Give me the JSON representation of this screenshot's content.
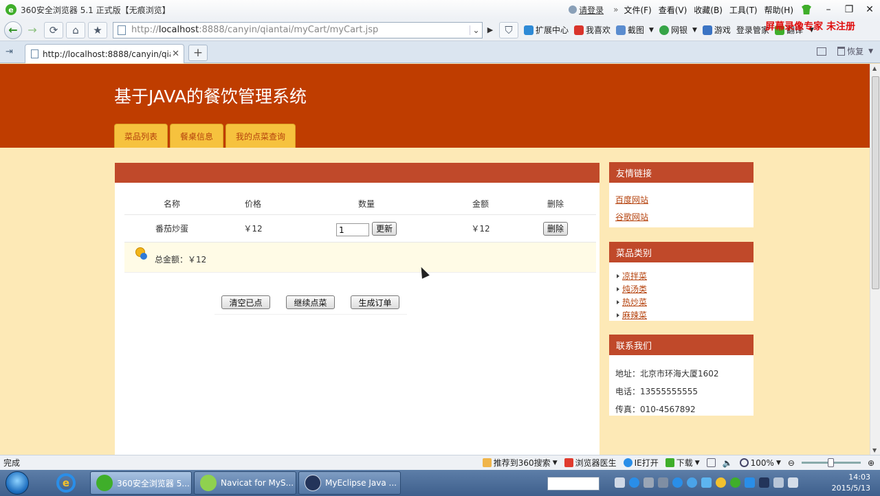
{
  "browser": {
    "window_title": "360安全浏览器 5.1 正式版【无痕浏览】",
    "login": "请登录",
    "menus": [
      "文件(F)",
      "查看(V)",
      "收藏(B)",
      "工具(T)",
      "帮助(H)"
    ],
    "url_prefix": "http://",
    "url_host": "localhost",
    "url_rest": ":8888/canyin/qiantai/myCart/myCart.jsp",
    "extensions": [
      "扩展中心",
      "我喜欢",
      "截图",
      "网银",
      "游戏",
      "登录管家",
      "翻译"
    ],
    "watermark": "屏幕录像专家 未注册",
    "tab_title": "http://localhost:8888/canyin/qia...",
    "restore": "恢复",
    "status": "完成",
    "status_items": [
      "推荐到360搜索",
      "浏览器医生",
      "IE打开",
      "下载"
    ],
    "zoom": "100%"
  },
  "site": {
    "title": "基于JAVA的餐饮管理系统",
    "nav": [
      "菜品列表",
      "餐桌信息",
      "我的点菜查询"
    ]
  },
  "cart": {
    "headers": [
      "名称",
      "价格",
      "数量",
      "金额",
      "删除"
    ],
    "items": [
      {
        "name": "番茄炒蛋",
        "price": "￥12",
        "qty": "1",
        "update": "更新",
        "amount": "￥12",
        "delete": "删除"
      }
    ],
    "total": "总金额：￥12",
    "actions": [
      "清空已点",
      "继续点菜",
      "生成订单"
    ]
  },
  "sidebar": {
    "links_title": "友情链接",
    "links": [
      "百度网站",
      "谷歌网站"
    ],
    "category_title": "菜品类别",
    "categories": [
      "凉拌菜",
      "炖汤类",
      "热炒菜",
      "麻辣菜"
    ],
    "contact_title": "联系我们",
    "contact": [
      "地址：北京市环海大厦1602",
      "电话：13555555555",
      "传真：010-4567892"
    ]
  },
  "taskbar": {
    "tasks": [
      "360安全浏览器 5...",
      "Navicat for MyS...",
      "MyEclipse Java ..."
    ],
    "time": "14:03",
    "date": "2015/5/13"
  }
}
